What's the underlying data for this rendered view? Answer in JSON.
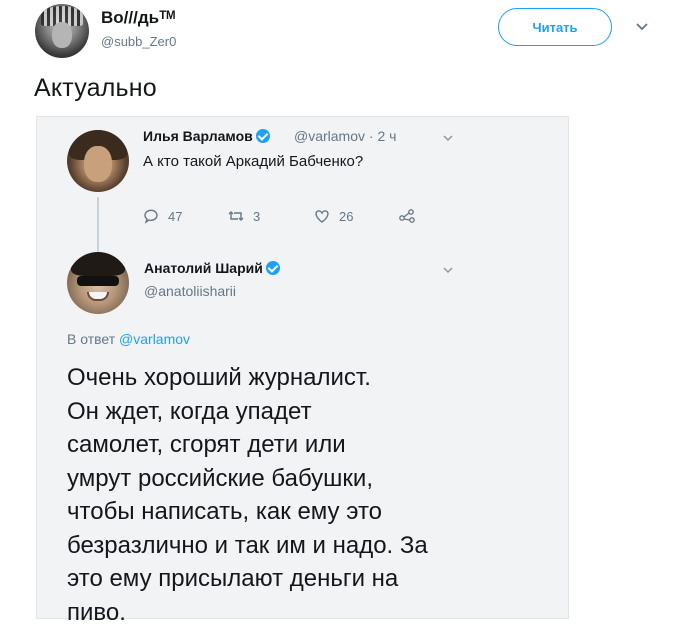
{
  "header": {
    "display_name": "Bo///дьᵀᴹ",
    "handle": "@subb_Zer0",
    "follow_label": "Читать",
    "avatar_icon": "avatar-icon",
    "caret_icon": "chevron-down-icon"
  },
  "tweet": {
    "text": "Актуально"
  },
  "screenshot": {
    "tweet1": {
      "name": "Илья Варламов",
      "handle": "@varlamov",
      "time": "· 2 ч",
      "text": "А кто такой Аркадий Бабченко?",
      "actions": {
        "reply_count": "47",
        "retweet_count": "3",
        "like_count": "26"
      }
    },
    "tweet2": {
      "name": "Анатолий Шарий",
      "handle": "@anatoliisharii",
      "reply_prefix": "В ответ",
      "reply_link": "@varlamov",
      "text": "Очень хороший журналист.\nОн ждет, когда упадет\nсамолет, сгорят дети или\nумрут российские бабушки,\nчтобы написать, как ему это\nбезразлично и так им и надо. За\nэто ему присылают деньги на\nпиво."
    }
  },
  "colors": {
    "accent": "#1da1f2",
    "secondary_text": "#657786",
    "primary_text": "#14171a"
  }
}
